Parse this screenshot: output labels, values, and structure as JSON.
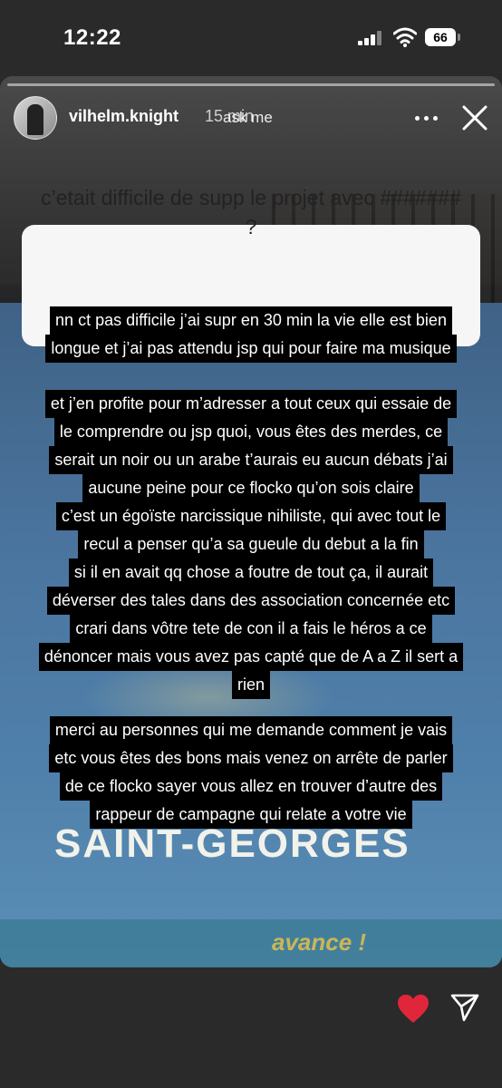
{
  "status_bar": {
    "time": "12:22",
    "battery": "66",
    "icons": [
      "cellular-signal-icon",
      "wifi-icon",
      "battery-icon"
    ]
  },
  "story": {
    "username": "vilhelm.knight",
    "time_ago": "15 min",
    "sticker_label": "ask me",
    "question": "c’etait difficile de supp le projet avec ####### ?",
    "blocks": [
      {
        "lines": [
          "nn ct pas difficile j’ai supr en 30 min la vie elle est bien",
          "longue et j’ai pas attendu jsp qui pour faire ma musique"
        ]
      },
      {
        "lines": [
          "et j’en profite pour m’adresser a tout ceux qui essaie de",
          "le comprendre ou jsp quoi, vous êtes des merdes, ce",
          "serait un noir ou un arabe t’aurais eu aucun débats j’ai",
          "aucune peine pour ce flocko qu’on sois claire",
          "c’est un égoïste narcissique nihiliste, qui avec tout le",
          "recul a penser qu’a sa gueule du debut a la fin",
          "si il en avait qq chose a foutre de tout ça, il aurait",
          "déverser des tales dans des association concernée etc",
          "crari dans vôtre tete de con il a fais le héros a ce",
          "dénoncer mais vous avez pas capté que de A a Z il sert a",
          "rien"
        ]
      },
      {
        "lines": [
          "merci au personnes qui me demande comment je vais",
          "etc vous êtes des bons mais venez on arrête de parler",
          "de ce flocko sayer vous allez en trouver d’autre des",
          "rappeur de campagne qui relate a votre vie"
        ]
      }
    ],
    "background_text": {
      "banner_main": "SAINT-GEORGES",
      "banner_script": "avance !"
    }
  },
  "colors": {
    "accent_heart": "#e0263a",
    "text_bg": "#000000",
    "card_bg": "#f6f6f6"
  }
}
